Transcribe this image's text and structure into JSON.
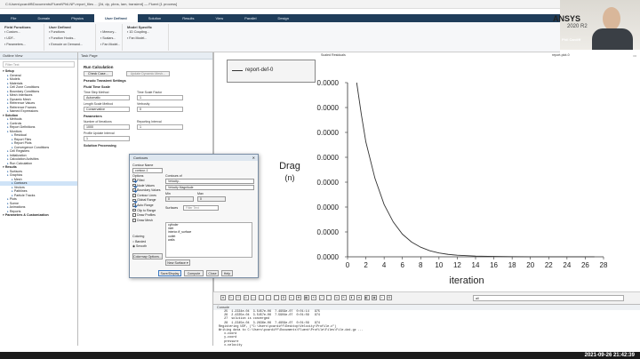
{
  "window": {
    "title": "C:\\Users\\pcardiff\\Documents\\Fluent\\Phil-NP-report_files ... [2d, dp, pbns, lam, transient] — Fluent [1 process]",
    "controls": "–  ☐  ✕"
  },
  "ribbon_tabs": [
    "File",
    "Domain",
    "Physics",
    "User Defined",
    "Solution",
    "Results",
    "View",
    "Parallel",
    "Design"
  ],
  "ribbon": {
    "groups": [
      {
        "title": "Field Functions",
        "items": [
          "Custom...",
          "UDF...",
          "Parameters..."
        ]
      },
      {
        "title": "User Defined",
        "items": [
          "Functions",
          "Function Hooks...",
          "Execute on Demand..."
        ]
      },
      {
        "title": "",
        "items": [
          "Memory...",
          "Scalars...",
          "Fan Model..."
        ]
      },
      {
        "title": "Model Specific",
        "items": [
          "1D Coupling...",
          "Fan Model..."
        ]
      }
    ]
  },
  "webcam": {
    "name": "Phil Cardiff"
  },
  "outline": {
    "title": "Outline View",
    "filter_placeholder": "Filter Text",
    "items": [
      {
        "label": "Setup",
        "indent": 0,
        "selected": false
      },
      {
        "label": "General",
        "indent": 1,
        "selected": false
      },
      {
        "label": "Models",
        "indent": 1,
        "selected": false
      },
      {
        "label": "Materials",
        "indent": 1,
        "selected": false
      },
      {
        "label": "Cell Zone Conditions",
        "indent": 1,
        "selected": false
      },
      {
        "label": "Boundary Conditions",
        "indent": 1,
        "selected": false
      },
      {
        "label": "Mesh Interfaces",
        "indent": 1,
        "selected": false
      },
      {
        "label": "Dynamic Mesh",
        "indent": 1,
        "selected": false
      },
      {
        "label": "Reference Values",
        "indent": 1,
        "selected": false
      },
      {
        "label": "Reference Frames",
        "indent": 1,
        "selected": false
      },
      {
        "label": "Named Expressions",
        "indent": 1,
        "selected": false
      },
      {
        "label": "Solution",
        "indent": 0,
        "selected": false
      },
      {
        "label": "Methods",
        "indent": 1,
        "selected": false
      },
      {
        "label": "Controls",
        "indent": 1,
        "selected": false
      },
      {
        "label": "Report Definitions",
        "indent": 1,
        "selected": false
      },
      {
        "label": "Monitors",
        "indent": 1,
        "selected": false
      },
      {
        "label": "Residual",
        "indent": 2,
        "selected": false
      },
      {
        "label": "Report Files",
        "indent": 2,
        "selected": false
      },
      {
        "label": "Report Plots",
        "indent": 2,
        "selected": false
      },
      {
        "label": "Convergence Conditions",
        "indent": 2,
        "selected": false
      },
      {
        "label": "Cell Registers",
        "indent": 1,
        "selected": false
      },
      {
        "label": "Initialization",
        "indent": 1,
        "selected": false
      },
      {
        "label": "Calculation Activities",
        "indent": 1,
        "selected": false
      },
      {
        "label": "Run Calculation",
        "indent": 1,
        "selected": false
      },
      {
        "label": "Results",
        "indent": 0,
        "selected": false
      },
      {
        "label": "Surfaces",
        "indent": 1,
        "selected": false
      },
      {
        "label": "Graphics",
        "indent": 1,
        "selected": false
      },
      {
        "label": "Mesh",
        "indent": 2,
        "selected": false
      },
      {
        "label": "Contours",
        "indent": 2,
        "selected": true
      },
      {
        "label": "Vectors",
        "indent": 2,
        "selected": false
      },
      {
        "label": "Pathlines",
        "indent": 2,
        "selected": false
      },
      {
        "label": "Particle Tracks",
        "indent": 2,
        "selected": false
      },
      {
        "label": "Plots",
        "indent": 1,
        "selected": false
      },
      {
        "label": "Scene",
        "indent": 1,
        "selected": false
      },
      {
        "label": "Animations",
        "indent": 1,
        "selected": false
      },
      {
        "label": "Reports",
        "indent": 1,
        "selected": false
      },
      {
        "label": "Parameters & Customization",
        "indent": 0,
        "selected": false
      }
    ]
  },
  "task_page": {
    "title": "Task Page",
    "heading": "Run Calculation",
    "check_case": "Check Case...",
    "update_mesh": "Update Dynamic Mesh...",
    "pseudo_heading": "Pseudo Transient Settings",
    "fluid_time_scale": "Fluid Time Scale",
    "time_step_method_label": "Time Step Method",
    "time_step_method": "Automatic",
    "time_scale_factor_label": "Time Scale Factor",
    "time_scale_factor": "1",
    "length_scale_method_label": "Length Scale Method",
    "length_scale_method": "Conservative",
    "verbosity_label": "Verbosity",
    "verbosity": "0",
    "parameters_heading": "Parameters",
    "iterations_label": "Number of Iterations",
    "iterations": "1000",
    "reporting_interval_label": "Reporting Interval",
    "reporting_interval": "1",
    "profile_update_label": "Profile Update Interval",
    "profile_update": "1",
    "solution_processing": "Solution Processing"
  },
  "contours_dialog": {
    "title": "Contours",
    "contour_name_label": "Contour Name",
    "contour_name": "contour-1",
    "options_label": "Options",
    "options": [
      {
        "label": "Filled",
        "checked": true
      },
      {
        "label": "Node Values",
        "checked": true
      },
      {
        "label": "Boundary Values",
        "checked": true
      },
      {
        "label": "Contour Lines",
        "checked": false
      },
      {
        "label": "Global Range",
        "checked": true
      },
      {
        "label": "Auto Range",
        "checked": true
      },
      {
        "label": "Clip to Range",
        "checked": false
      },
      {
        "label": "Draw Profiles",
        "checked": false
      },
      {
        "label": "Draw Mesh",
        "checked": false
      }
    ],
    "contours_of_label": "Contours of",
    "contours_of": "Velocity...",
    "contours_of_sub": "Velocity Magnitude",
    "min_label": "Min",
    "max_label": "Max",
    "min": "0",
    "max": "0",
    "surfaces_label": "Surfaces",
    "filter_placeholder": "Filter Text",
    "surfaces": [
      "cylinder",
      "inlet",
      "interior-ff_surface",
      "outlet",
      "walls"
    ],
    "coloring_label": "Coloring",
    "coloring": [
      {
        "label": "Banded",
        "selected": false
      },
      {
        "label": "Smooth",
        "selected": true
      }
    ],
    "colormap_btn": "Colormap Options...",
    "new_surface_btn": "New Surface ▾",
    "buttons": [
      "Save/Display",
      "Compute",
      "Close",
      "Help"
    ]
  },
  "graphics": {
    "tabs": [
      "Scaled Residuals",
      "report-plot-0"
    ],
    "brand": "ANSYS",
    "version": "2020 R2",
    "legend_label": "report-def-0"
  },
  "chart_data": {
    "type": "line",
    "ylabel": "Drag\n(n)",
    "xlabel": "iteration",
    "x_ticks": [
      0,
      2,
      4,
      6,
      8,
      10,
      12,
      14,
      16,
      18,
      20,
      22,
      24,
      26,
      28
    ],
    "y_tick_labels": [
      "0.0000",
      "0.0000",
      "0.0000",
      "0.0000",
      "0.0000",
      "0.0000",
      "0.0000",
      "0.0000"
    ],
    "xlim": [
      0,
      28
    ],
    "series": [
      {
        "name": "report-def-0",
        "x": [
          1,
          1.5,
          2,
          3,
          4,
          5,
          6,
          7,
          8,
          9,
          10,
          11,
          12,
          14,
          16,
          18,
          20,
          22,
          24,
          27
        ],
        "y": [
          1.0,
          0.82,
          0.66,
          0.45,
          0.3,
          0.2,
          0.13,
          0.085,
          0.055,
          0.035,
          0.022,
          0.014,
          0.009,
          0.004,
          0.002,
          0.001,
          0.0005,
          0.0003,
          0.0002,
          0.0001
        ]
      }
    ],
    "grid": false
  },
  "graphics_toolbar": {
    "tools": [
      "⊕",
      "↻",
      "⤧",
      "⊙",
      "▭",
      "↔",
      "↕",
      "⬚",
      "⚙",
      "◐",
      "✥",
      "▦",
      "⟲",
      "⤢",
      "⛶",
      "⇲",
      "⇱",
      "⬍",
      "⬌",
      "◧",
      "▣",
      "⌖",
      "⊞"
    ],
    "selector": "all"
  },
  "console": {
    "title": "Console",
    "lines": [
      "   25  1.2334e-04  3.5457e-06  7.4959e-07  0:01:14   975",
      "   26  2.4335e-04  3.5457e-06  7.5904e-07  0:01:09   974",
      "   27  solution is converged",
      "   28  1.2345e-04  3.2836e-06  7.4959e-07  0:01:09   974",
      "Registering UDF, (\"C:\\Users\\pcardiff\\Desktop\\Velocity\\Profile.c\")",
      "Writing data to C:\\Users\\pcardiff\\Documents\\Fluent\\Profile\\Files\\File.dat.gz ...",
      "   x-coord",
      "   y-coord",
      "   pressure",
      "   x-velocity"
    ]
  },
  "clock": "2021-09-26  21:42:39"
}
